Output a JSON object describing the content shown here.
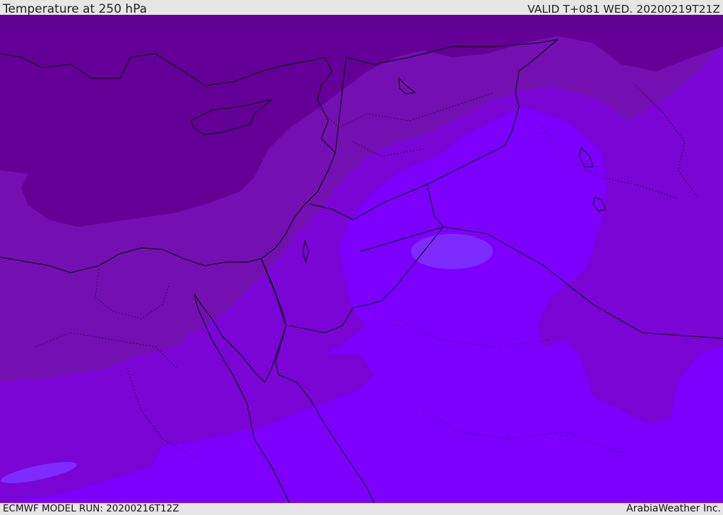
{
  "header": {
    "title": "Temperature at 250 hPa",
    "valid": "VALID T+081 WED. 20200219T21Z"
  },
  "footer": {
    "model_run": "ECMWF MODEL RUN: 20200216T12Z",
    "credit": "ArabiaWeather Inc."
  },
  "colors": {
    "band_coldest": "#630096",
    "band_cold": "#7210b2",
    "band_mid": "#7a05d4",
    "band_warm": "#7d00ff",
    "band_warmest": "#7d2bff",
    "coastline": "#000000",
    "frame": "#e6e6e6"
  }
}
